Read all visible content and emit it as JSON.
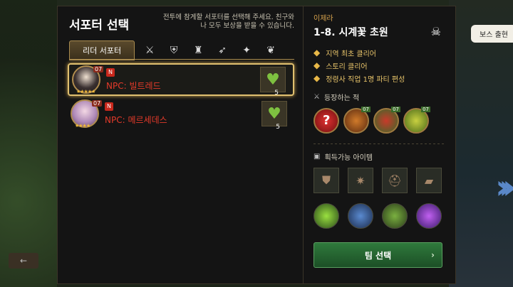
{
  "left": {
    "title": "서포터 선택",
    "desc": "전투에 참게할 서포터를 선택해 주세요. 친구와 나 모두 보상을 받을 수 있습니다.",
    "tabs": {
      "active": "리더 서포터"
    },
    "supporters": [
      {
        "name": "NPC: 빌트레드",
        "level": "07",
        "stars": "★★★★★",
        "badge": "N",
        "count": "5",
        "selected": true
      },
      {
        "name": "NPC: 메르세데스",
        "level": "07",
        "stars": "★★★★",
        "badge": "N",
        "count": "5",
        "selected": false
      }
    ]
  },
  "right": {
    "region": "이제라",
    "stage": "1-8. 시계꽃 초원",
    "boss_label": "보스 출현",
    "objectives": [
      "지역 최초 클리어",
      "스토리 클리어",
      "정령사 직업 1명 파티 편성"
    ],
    "enemies_title": "등장하는 적",
    "enemies": [
      {
        "lv": "07"
      },
      {
        "lv": "07"
      },
      {
        "lv": "07"
      }
    ],
    "items_title": "획득가능 아이템",
    "team_button": "팀 선택"
  },
  "colors": {
    "accent": "#e0c070",
    "npc": "#e43a2a",
    "team": "#2f7a3c"
  }
}
